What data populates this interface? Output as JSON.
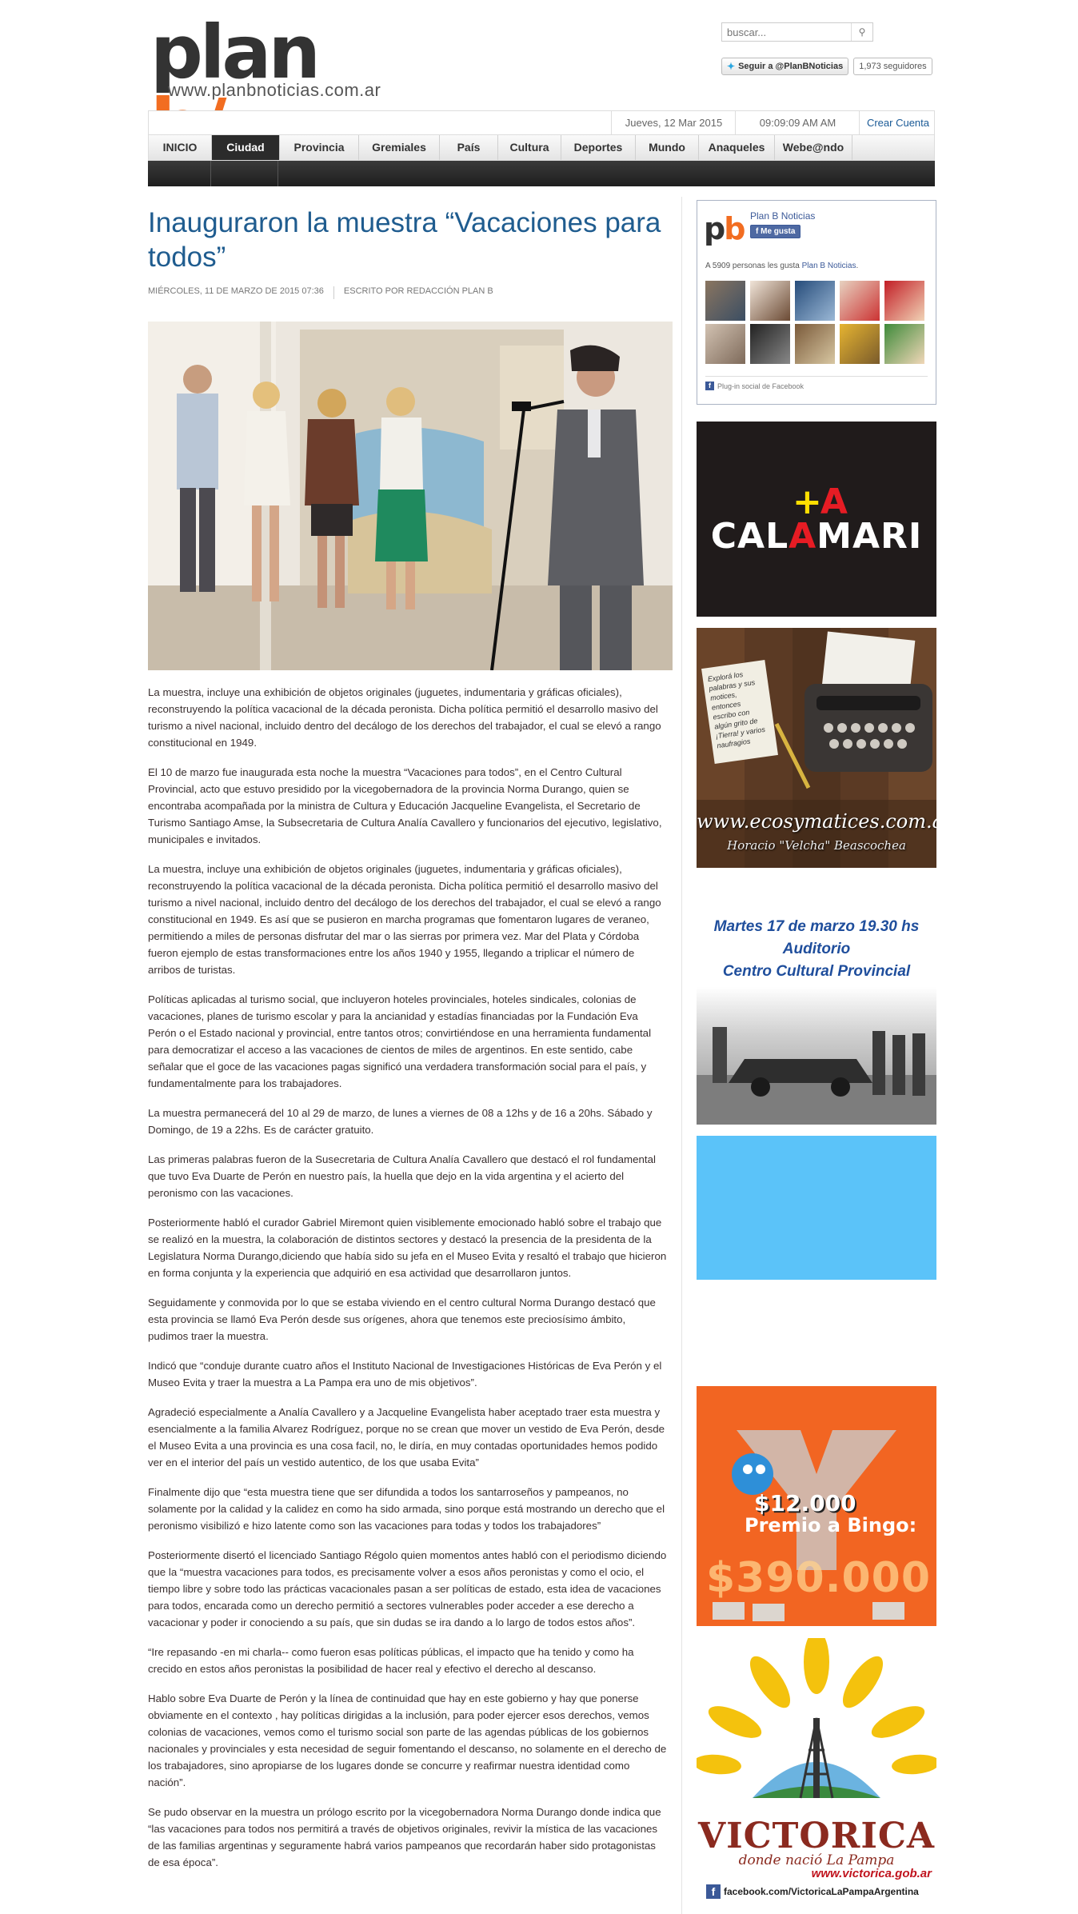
{
  "header": {
    "logo_main": "plan ",
    "logo_accent": "b/",
    "logo_url": "www.planbnoticias.com.ar",
    "search_placeholder": "buscar...",
    "twitter_follow": "Seguir a @PlanBNoticias",
    "twitter_followers": "1,973 seguidores"
  },
  "topbar": {
    "date": "Jueves, 12 Mar 2015",
    "time": "09:09:09 AM AM",
    "create_account": "Crear Cuenta"
  },
  "nav": {
    "active": "Ciudad",
    "items": [
      "INICIO",
      "Ciudad",
      "Provincia",
      "Gremiales",
      "País",
      "Cultura",
      "Deportes",
      "Mundo",
      "Anaqueles",
      "Webe@ndo"
    ]
  },
  "article": {
    "title": "Inauguraron la muestra “Vacaciones para todos”",
    "date": "MIÉRCOLES, 11 DE MARZO DE 2015 07:36",
    "author": "ESCRITO POR REDACCIÓN PLAN B",
    "paragraphs": [
      "La muestra, incluye una exhibición de objetos originales (juguetes, indumentaria y gráficas oficiales), reconstruyendo la política vacacional de la década peronista. Dicha política permitió el desarrollo masivo del turismo a nivel nacional, incluido dentro del decálogo de los derechos del trabajador, el cual se elevó a rango constitucional en 1949.",
      "El 10 de marzo fue inaugurada esta noche la muestra “Vacaciones para todos”, en el Centro Cultural Provincial, acto que estuvo presidido por la vicegobernadora de la provincia Norma Durango, quien se encontraba acompañada por la ministra de Cultura y Educación Jacqueline Evangelista, el Secretario de Turismo Santiago Amse, la Subsecretaria de Cultura Analía Cavallero y funcionarios del ejecutivo, legislativo, municipales e invitados.",
      "La muestra, incluye una exhibición de objetos originales (juguetes, indumentaria y gráficas oficiales), reconstruyendo la política vacacional de la década peronista. Dicha política permitió el desarrollo masivo del turismo a nivel nacional, incluido dentro del decálogo de los derechos del trabajador, el cual se elevó a rango constitucional en 1949. Es así que se pusieron en marcha programas que fomentaron lugares de veraneo, permitiendo a miles de personas disfrutar del mar o las sierras por primera vez. Mar del Plata y Córdoba fueron ejemplo de estas transformaciones entre los años 1940 y 1955, llegando a triplicar el número de arribos de turistas.",
      "Políticas aplicadas al turismo social, que incluyeron hoteles provinciales, hoteles sindicales, colonias de vacaciones, planes de turismo escolar y para la ancianidad y estadías financiadas por la Fundación Eva Perón o el Estado nacional y provincial, entre tantos otros; convirtiéndose en una herramienta fundamental para democratizar el acceso a las vacaciones de cientos de miles de argentinos. En este sentido, cabe señalar que el goce de las vacaciones pagas significó una verdadera transformación social para el país, y fundamentalmente para los trabajadores.",
      "La muestra permanecerá del 10 al 29 de marzo, de lunes a viernes de 08 a 12hs y de 16 a 20hs. Sábado y Domingo, de 19 a 22hs. Es de carácter gratuito.",
      "Las primeras palabras fueron de la Susecretaria de Cultura Analía Cavallero que destacó el rol fundamental que tuvo Eva Duarte de Perón en nuestro país, la huella que dejo en la vida argentina y el acierto del peronismo con las vacaciones.",
      "Posteriormente habló el curador Gabriel Miremont quien visiblemente emocionado habló sobre el trabajo que se realizó en la muestra, la colaboración de distintos sectores y destacó la presencia de la presidenta de la Legislatura Norma Durango,diciendo que había sido su jefa en el Museo Evita y resaltó el trabajo que hicieron en forma conjunta y la experiencia que adquirió en esa actividad que desarrollaron juntos.",
      "Seguidamente y conmovida por lo que se estaba viviendo en el centro cultural Norma Durango destacó que esta provincia se llamó Eva Perón desde sus orígenes, ahora que tenemos este preciosísimo ámbito, pudimos traer la muestra.",
      "Indicó que “conduje durante cuatro años el Instituto Nacional de Investigaciones Históricas de Eva Perón y el Museo Evita y traer la muestra a La Pampa era uno de mis objetivos”.",
      "Agradeció especialmente a Analía Cavallero y a Jacqueline Evangelista haber aceptado traer esta muestra y esencialmente a la familia Alvarez Rodríguez, porque no se crean que mover un vestido de Eva Perón, desde el Museo Evita a una provincia es una cosa facil, no, le diría, en muy contadas oportunidades hemos podido ver en el interior del país un vestido autentico, de los que usaba Evita”",
      "Finalmente dijo que “esta muestra tiene que ser difundida a todos los santarroseños y pampeanos, no solamente por la calidad y la calidez en como ha sido armada, sino porque está mostrando un derecho que el peronismo visibilizó e hizo latente como son las vacaciones para todas y todos los trabajadores”",
      "Posteriormente disertó el licenciado Santiago Régolo quien momentos antes habló con el periodismo diciendo que la “muestra vacaciones para todos, es precisamente volver a esos años peronistas y como el ocio, el tiempo libre y sobre todo las prácticas vacacionales pasan a ser políticas de estado, esta idea de vacaciones para todos, encarada como un derecho permitió a sectores vulnerables poder acceder a ese derecho a vacacionar y poder ir conociendo a su país, que sin dudas se ira dando a lo largo de todos estos años”.",
      "“Ire repasando -en mi charla-- como fueron esas políticas públicas, el impacto que ha tenido y como ha crecido en estos años peronistas la posibilidad de hacer real y efectivo el derecho al descanso.",
      "Hablo sobre Eva Duarte de Perón y la línea de continuidad que hay en este gobierno y hay que ponerse obviamente en el contexto , hay políticas dirigidas a la inclusión, para poder ejercer esos derechos, vemos colonias de vacaciones, vemos como el turismo social son parte de las agendas públicas de los gobiernos nacionales y provinciales y esta necesidad de seguir fomentando el descanso, no solamente en el derecho de los trabajadores, sino apropiarse de los lugares donde se concurre y reafirmar nuestra identidad como nación”.",
      "Se pudo observar en la muestra un prólogo escrito por la vicegobernadora Norma Durango donde indica que “las vacaciones para todos nos permitirá a través de objetivos originales, revivir la mística de las vacaciones de las familias argentinas y seguramente habrá varios pampeanos que recordarán haber sido protagonistas de esa época”."
    ]
  },
  "sidebar": {
    "fb": {
      "logo_p": "p",
      "logo_b": "b",
      "page_name": "Plan B Noticias",
      "like_label": "Me gusta",
      "likes_prefix": "A 5909 personas les gusta ",
      "likes_page": "Plan B Noticias",
      "likes_suffix": ".",
      "plugin_label": "Plug-in social de Facebook"
    },
    "calamari": {
      "plus": "+",
      "a": "A",
      "word_pre": "CAL",
      "word_a": "A",
      "word_post": "MARI"
    },
    "eco": {
      "note": "Explorá los palabras y sus motices, entonces escribo con algún grito de ¡Tierra! y varios naufragios",
      "url": "www.ecosymatices.com.ar",
      "author": "Horacio \"Velcha\" Beascochea"
    },
    "event": {
      "line1": "Martes 17 de marzo 19.30 hs",
      "line2": "Auditorio",
      "line3": "Centro Cultural Provincial"
    },
    "bingo": {
      "small": "$12.000",
      "prize": "Premio a Bingo:",
      "amount": "$390.000"
    },
    "victorica": {
      "title": "VICTORICA",
      "subtitle": "donde nació La Pampa",
      "url": "www.victorica.gob.ar",
      "facebook": "facebook.com/VictoricaLaPampaArgentina"
    }
  },
  "colors": {
    "accent": "#f26d21",
    "title_blue": "#1f5c8f",
    "nav_active": "#2b2b2b",
    "facebook": "#3b5998"
  }
}
